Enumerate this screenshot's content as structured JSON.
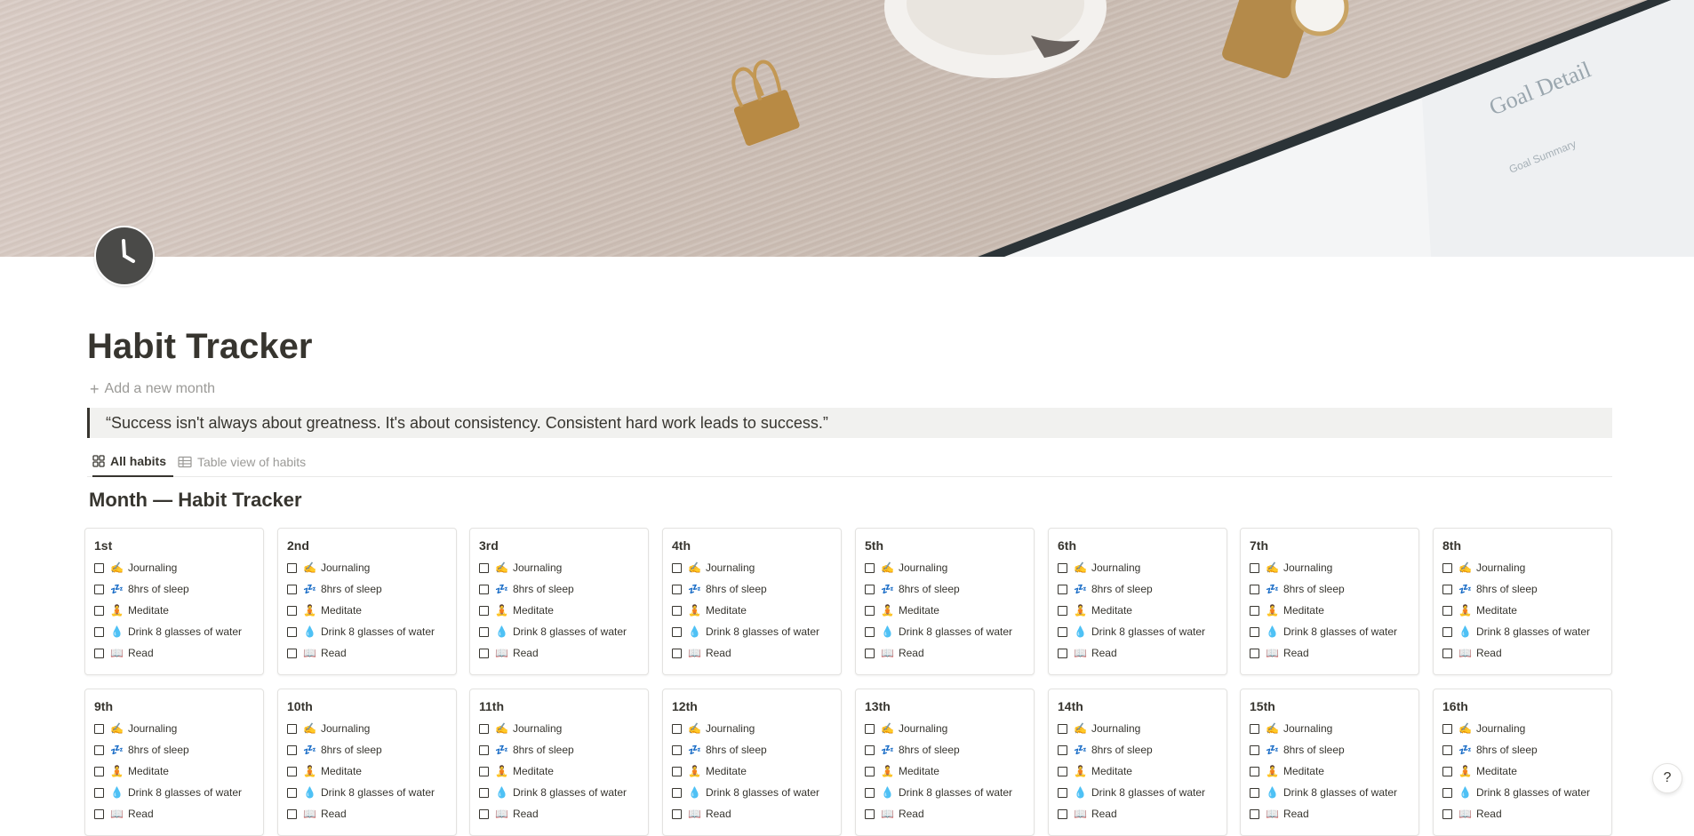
{
  "page": {
    "title": "Habit Tracker",
    "add_month_label": "Add a new month",
    "quote": "“Success isn't always about greatness. It's about consistency. Consistent hard work leads to success.”",
    "section_title": "Month — Habit Tracker"
  },
  "tabs": [
    {
      "label": "All habits",
      "icon": "gallery-icon",
      "active": true
    },
    {
      "label": "Table view of habits",
      "icon": "table-icon",
      "active": false
    }
  ],
  "habits": [
    {
      "emoji": "✍️",
      "label": "Journaling"
    },
    {
      "emoji": "💤",
      "label": "8hrs of sleep"
    },
    {
      "emoji": "🧘",
      "label": "Meditate"
    },
    {
      "emoji": "💧",
      "label": "Drink 8 glasses of water"
    },
    {
      "emoji": "📖",
      "label": "Read"
    }
  ],
  "days": [
    "1st",
    "2nd",
    "3rd",
    "4th",
    "5th",
    "6th",
    "7th",
    "8th",
    "9th",
    "10th",
    "11th",
    "12th",
    "13th",
    "14th",
    "15th",
    "16th"
  ],
  "help_label": "?",
  "colors": {
    "text": "#37352f",
    "muted": "#9b9a97",
    "quote_bg": "#f1f1ef",
    "icon_bg": "#4a4a48"
  }
}
